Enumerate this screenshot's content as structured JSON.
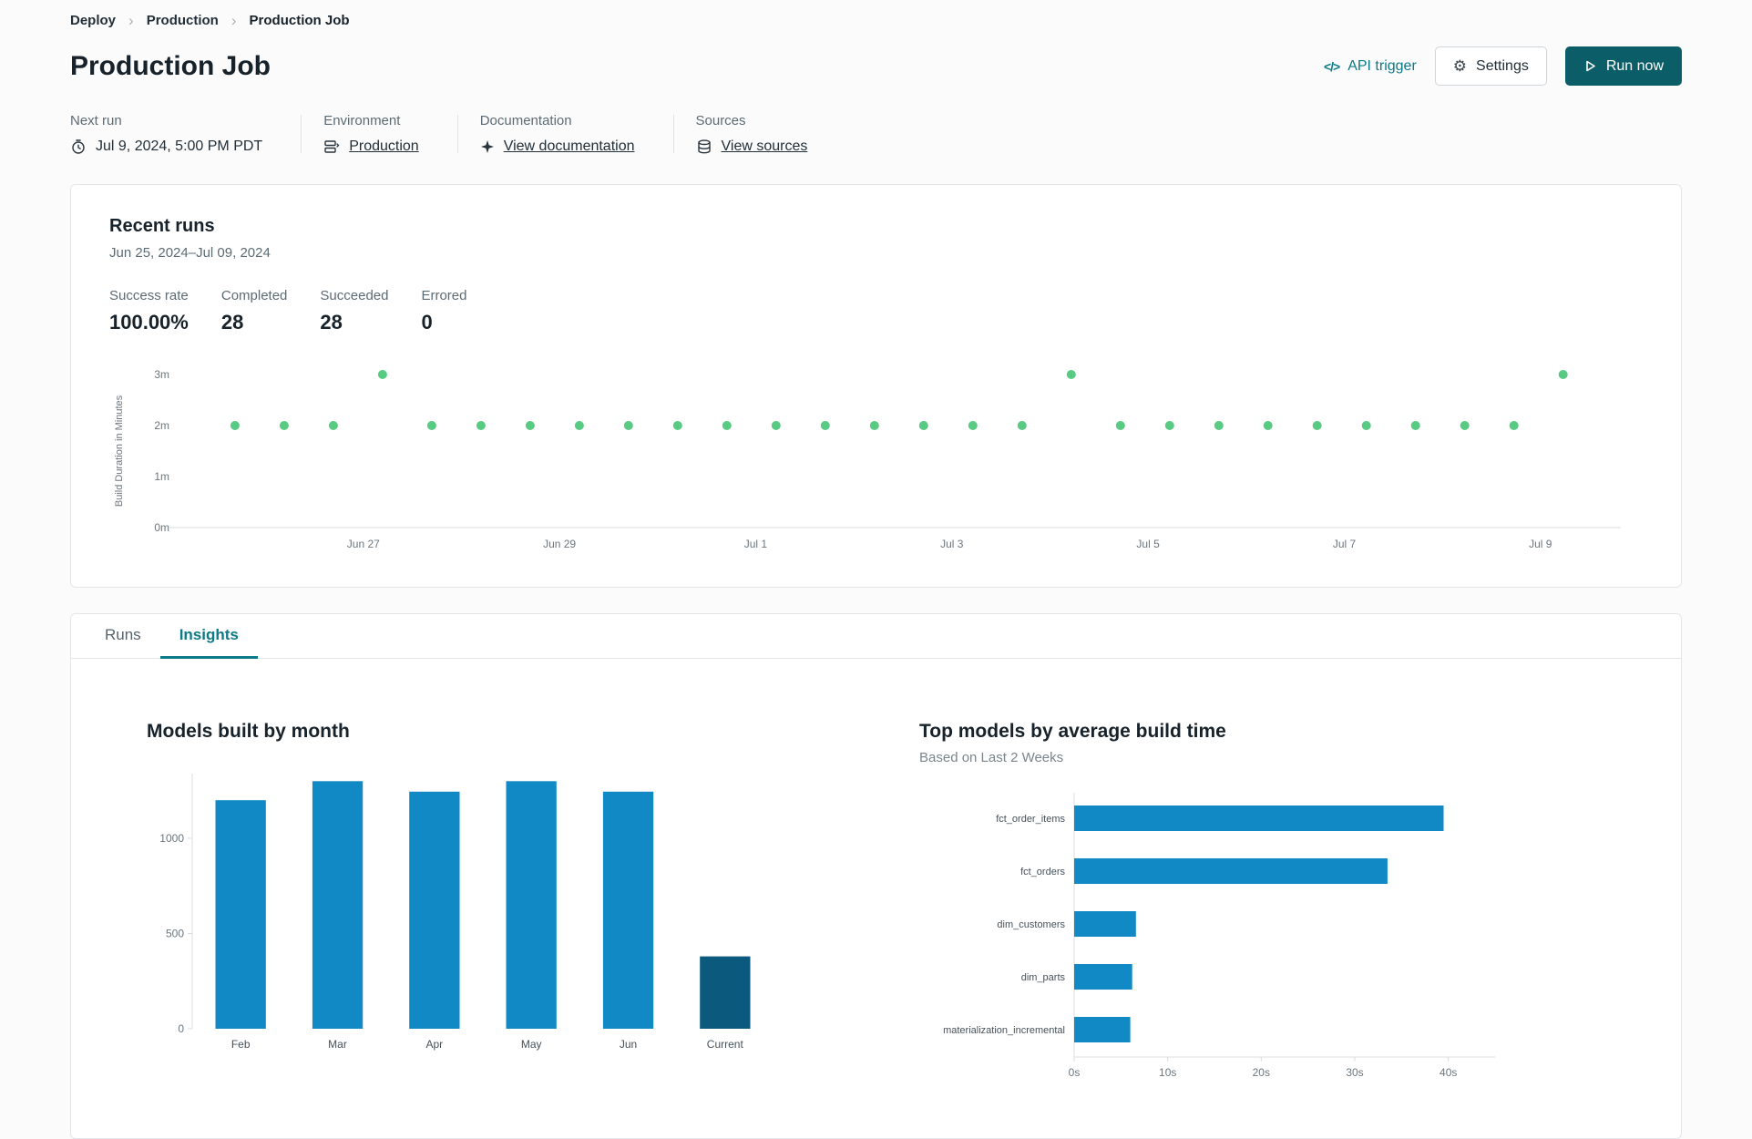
{
  "breadcrumb": {
    "items": [
      {
        "label": "Deploy"
      },
      {
        "label": "Production"
      },
      {
        "label": "Production Job"
      }
    ]
  },
  "header": {
    "title": "Production Job",
    "api_trigger_label": "API trigger",
    "settings_label": "Settings",
    "run_now_label": "Run now"
  },
  "meta": {
    "next_run": {
      "label": "Next run",
      "value": "Jul 9, 2024, 5:00 PM PDT"
    },
    "environment": {
      "label": "Environment",
      "link": "Production"
    },
    "documentation": {
      "label": "Documentation",
      "link": "View documentation"
    },
    "sources": {
      "label": "Sources",
      "link": "View sources"
    }
  },
  "recent_runs": {
    "title": "Recent runs",
    "date_range": "Jun 25, 2024–Jul 09, 2024",
    "stats": [
      {
        "label": "Success rate",
        "value": "100.00%"
      },
      {
        "label": "Completed",
        "value": "28"
      },
      {
        "label": "Succeeded",
        "value": "28"
      },
      {
        "label": "Errored",
        "value": "0"
      }
    ]
  },
  "tabs": [
    {
      "label": "Runs",
      "active": false
    },
    {
      "label": "Insights",
      "active": true
    }
  ],
  "chart_data": [
    {
      "name": "recent-runs-build-duration",
      "type": "scatter",
      "ylabel": "Build Duration in Minutes",
      "yticks": [
        "0m",
        "1m",
        "2m",
        "3m"
      ],
      "ylim_minutes": [
        0,
        3
      ],
      "x_tick_labels": [
        "Jun 27",
        "Jun 29",
        "Jul 1",
        "Jul 3",
        "Jul 5",
        "Jul 7",
        "Jul 9"
      ],
      "points_minutes": [
        2,
        2,
        2,
        3,
        2,
        2,
        2,
        2,
        2,
        2,
        2,
        2,
        2,
        2,
        2,
        2,
        2,
        3,
        2,
        2,
        2,
        2,
        2,
        2,
        2,
        2,
        2,
        3
      ],
      "point_color": "#57cb81"
    },
    {
      "name": "models-built-by-month",
      "type": "bar",
      "title": "Models built by month",
      "categories": [
        "Feb",
        "Mar",
        "Apr",
        "May",
        "Jun",
        "Current"
      ],
      "values": [
        1200,
        1300,
        1245,
        1300,
        1245,
        380
      ],
      "yticks": [
        0,
        500,
        1000
      ],
      "ylim": [
        0,
        1380
      ],
      "bar_color": "#1089c5",
      "current_color": "#0b5a7d",
      "highlight_category": "Current"
    },
    {
      "name": "top-models-by-average-build-time",
      "type": "bar_horizontal",
      "title": "Top models by average build time",
      "subtitle": "Based on Last 2 Weeks",
      "categories": [
        "fct_order_items",
        "fct_orders",
        "dim_customers",
        "dim_parts",
        "materialization_incremental"
      ],
      "values_seconds": [
        39.5,
        33.5,
        6.6,
        6.2,
        6.0
      ],
      "xticks": [
        "0s",
        "10s",
        "20s",
        "30s",
        "40s"
      ],
      "xlim": [
        0,
        45
      ],
      "bar_color": "#1089c5"
    }
  ],
  "colors": {
    "accent_teal": "#0d7a87",
    "primary_button": "#0b5d67",
    "success_green": "#57cb81",
    "chart_blue": "#1089c5",
    "chart_dark_teal": "#0b5a7d"
  }
}
